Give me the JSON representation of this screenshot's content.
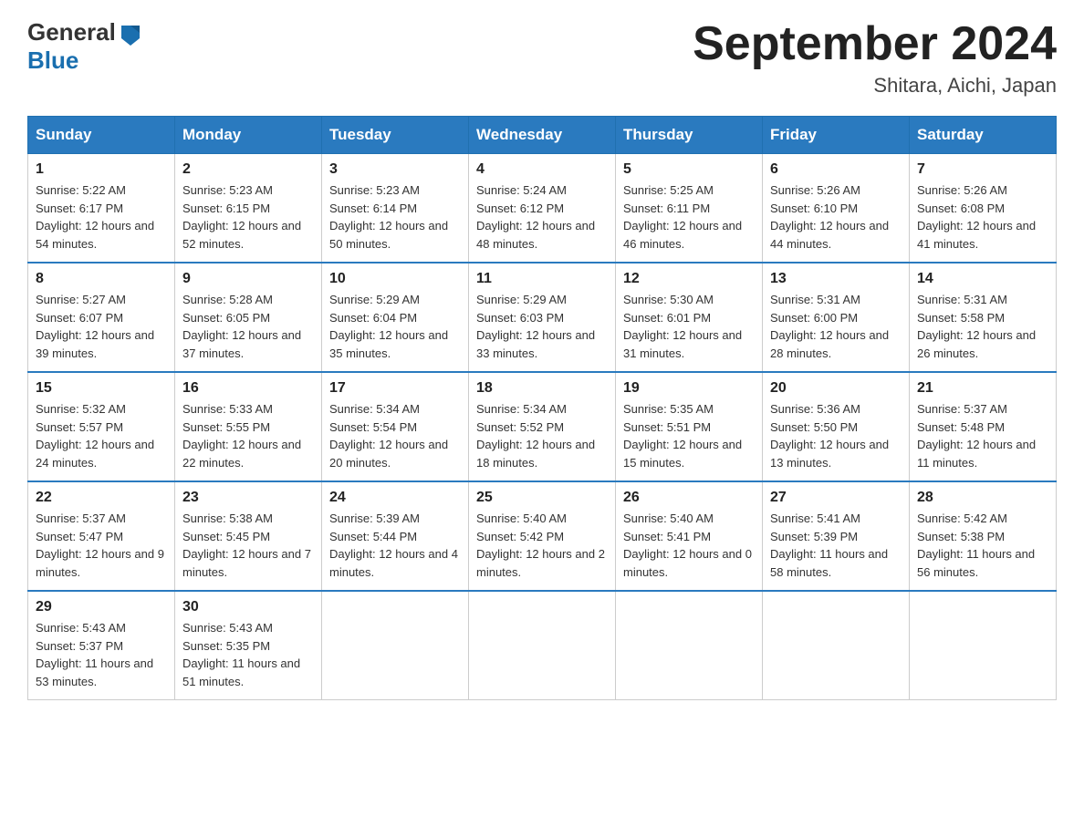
{
  "logo": {
    "text_general": "General",
    "text_blue": "Blue"
  },
  "title": "September 2024",
  "subtitle": "Shitara, Aichi, Japan",
  "days_of_week": [
    "Sunday",
    "Monday",
    "Tuesday",
    "Wednesday",
    "Thursday",
    "Friday",
    "Saturday"
  ],
  "weeks": [
    [
      {
        "day": "1",
        "sunrise": "5:22 AM",
        "sunset": "6:17 PM",
        "daylight": "12 hours and 54 minutes."
      },
      {
        "day": "2",
        "sunrise": "5:23 AM",
        "sunset": "6:15 PM",
        "daylight": "12 hours and 52 minutes."
      },
      {
        "day": "3",
        "sunrise": "5:23 AM",
        "sunset": "6:14 PM",
        "daylight": "12 hours and 50 minutes."
      },
      {
        "day": "4",
        "sunrise": "5:24 AM",
        "sunset": "6:12 PM",
        "daylight": "12 hours and 48 minutes."
      },
      {
        "day": "5",
        "sunrise": "5:25 AM",
        "sunset": "6:11 PM",
        "daylight": "12 hours and 46 minutes."
      },
      {
        "day": "6",
        "sunrise": "5:26 AM",
        "sunset": "6:10 PM",
        "daylight": "12 hours and 44 minutes."
      },
      {
        "day": "7",
        "sunrise": "5:26 AM",
        "sunset": "6:08 PM",
        "daylight": "12 hours and 41 minutes."
      }
    ],
    [
      {
        "day": "8",
        "sunrise": "5:27 AM",
        "sunset": "6:07 PM",
        "daylight": "12 hours and 39 minutes."
      },
      {
        "day": "9",
        "sunrise": "5:28 AM",
        "sunset": "6:05 PM",
        "daylight": "12 hours and 37 minutes."
      },
      {
        "day": "10",
        "sunrise": "5:29 AM",
        "sunset": "6:04 PM",
        "daylight": "12 hours and 35 minutes."
      },
      {
        "day": "11",
        "sunrise": "5:29 AM",
        "sunset": "6:03 PM",
        "daylight": "12 hours and 33 minutes."
      },
      {
        "day": "12",
        "sunrise": "5:30 AM",
        "sunset": "6:01 PM",
        "daylight": "12 hours and 31 minutes."
      },
      {
        "day": "13",
        "sunrise": "5:31 AM",
        "sunset": "6:00 PM",
        "daylight": "12 hours and 28 minutes."
      },
      {
        "day": "14",
        "sunrise": "5:31 AM",
        "sunset": "5:58 PM",
        "daylight": "12 hours and 26 minutes."
      }
    ],
    [
      {
        "day": "15",
        "sunrise": "5:32 AM",
        "sunset": "5:57 PM",
        "daylight": "12 hours and 24 minutes."
      },
      {
        "day": "16",
        "sunrise": "5:33 AM",
        "sunset": "5:55 PM",
        "daylight": "12 hours and 22 minutes."
      },
      {
        "day": "17",
        "sunrise": "5:34 AM",
        "sunset": "5:54 PM",
        "daylight": "12 hours and 20 minutes."
      },
      {
        "day": "18",
        "sunrise": "5:34 AM",
        "sunset": "5:52 PM",
        "daylight": "12 hours and 18 minutes."
      },
      {
        "day": "19",
        "sunrise": "5:35 AM",
        "sunset": "5:51 PM",
        "daylight": "12 hours and 15 minutes."
      },
      {
        "day": "20",
        "sunrise": "5:36 AM",
        "sunset": "5:50 PM",
        "daylight": "12 hours and 13 minutes."
      },
      {
        "day": "21",
        "sunrise": "5:37 AM",
        "sunset": "5:48 PM",
        "daylight": "12 hours and 11 minutes."
      }
    ],
    [
      {
        "day": "22",
        "sunrise": "5:37 AM",
        "sunset": "5:47 PM",
        "daylight": "12 hours and 9 minutes."
      },
      {
        "day": "23",
        "sunrise": "5:38 AM",
        "sunset": "5:45 PM",
        "daylight": "12 hours and 7 minutes."
      },
      {
        "day": "24",
        "sunrise": "5:39 AM",
        "sunset": "5:44 PM",
        "daylight": "12 hours and 4 minutes."
      },
      {
        "day": "25",
        "sunrise": "5:40 AM",
        "sunset": "5:42 PM",
        "daylight": "12 hours and 2 minutes."
      },
      {
        "day": "26",
        "sunrise": "5:40 AM",
        "sunset": "5:41 PM",
        "daylight": "12 hours and 0 minutes."
      },
      {
        "day": "27",
        "sunrise": "5:41 AM",
        "sunset": "5:39 PM",
        "daylight": "11 hours and 58 minutes."
      },
      {
        "day": "28",
        "sunrise": "5:42 AM",
        "sunset": "5:38 PM",
        "daylight": "11 hours and 56 minutes."
      }
    ],
    [
      {
        "day": "29",
        "sunrise": "5:43 AM",
        "sunset": "5:37 PM",
        "daylight": "11 hours and 53 minutes."
      },
      {
        "day": "30",
        "sunrise": "5:43 AM",
        "sunset": "5:35 PM",
        "daylight": "11 hours and 51 minutes."
      },
      null,
      null,
      null,
      null,
      null
    ]
  ]
}
